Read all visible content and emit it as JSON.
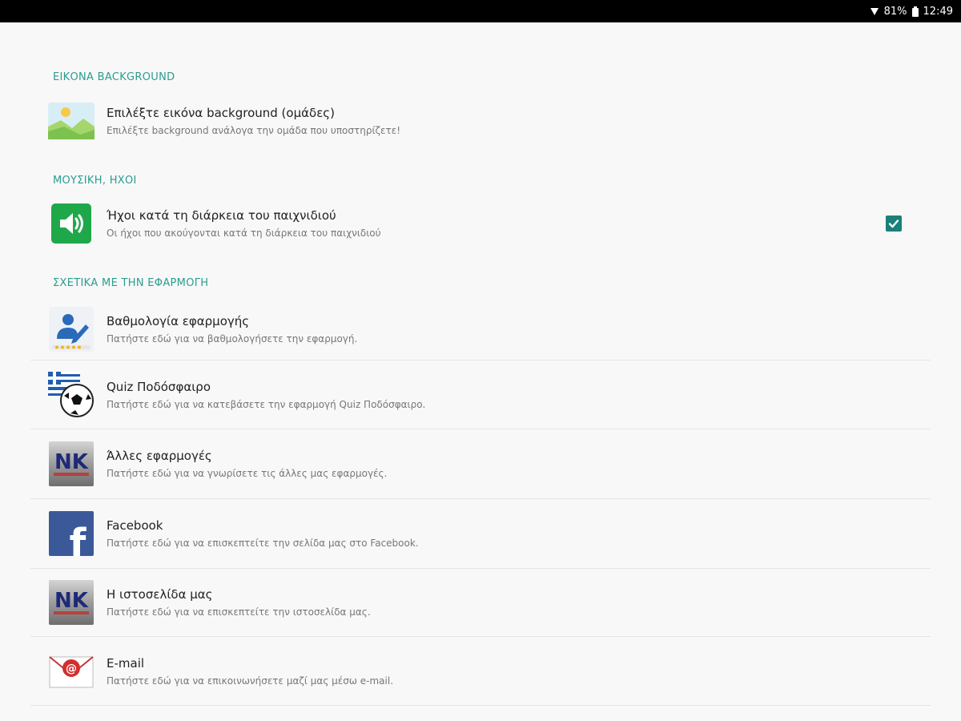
{
  "status_bar": {
    "battery": "81%",
    "time": "12:49"
  },
  "sections": {
    "background": {
      "header": "ΕΙΚΟΝΑ BACKGROUND",
      "items": [
        {
          "title": "Επιλέξτε εικόνα background (ομάδες)",
          "summary": "Επιλέξτε background ανάλογα την ομάδα που υποστηρίζετε!",
          "icon": "landscape-image-icon"
        }
      ]
    },
    "music": {
      "header": "ΜΟΥΣΙΚΗ, ΗΧΟΙ",
      "items": [
        {
          "title": "Ήχοι κατά τη διάρκεια του παιχνιδιού",
          "summary": "Οι ήχοι που ακούγονται κατά τη διάρκεια του παιχνιδιού",
          "icon": "speaker-icon",
          "checked": true
        }
      ]
    },
    "about": {
      "header": "ΣΧΕΤΙΚΑ ΜΕ ΤΗΝ ΕΦΑΡΜΟΓΗ",
      "items": [
        {
          "title": "Βαθμολογία εφαρμογής",
          "summary": "Πατήστε εδώ για να βαθμολογήσετε την εφαρμογή.",
          "icon": "rate-app-icon"
        },
        {
          "title": "Quiz Ποδόσφαιρο",
          "summary": "Πατήστε εδώ για να κατεβάσετε την εφαρμογή Quiz Ποδόσφαιρο.",
          "icon": "soccer-ball-icon"
        },
        {
          "title": "Άλλες εφαρμογές",
          "summary": "Πατήστε εδώ για να γνωρίσετε τις άλλες μας εφαρμογές.",
          "icon": "nk-logo-icon",
          "logo_text": "NK"
        },
        {
          "title": "Facebook",
          "summary": "Πατήστε εδώ για να επισκεπτείτε την σελίδα μας στο Facebook.",
          "icon": "facebook-icon",
          "logo_text": "f"
        },
        {
          "title": "Η ιστοσελίδα μας",
          "summary": "Πατήστε εδώ για να επισκεπτείτε την ιστοσελίδα μας.",
          "icon": "nk-logo-icon",
          "logo_text": "NK"
        },
        {
          "title": "E-mail",
          "summary": "Πατήστε εδώ για να επικοινωνήσετε μαζί μας μέσω e-mail.",
          "icon": "email-envelope-icon",
          "logo_text": "@"
        }
      ]
    }
  },
  "colors": {
    "accent": "#2a9d8f",
    "checkbox": "#1a8079",
    "facebook": "#3b5998",
    "speaker_green": "#1ea84a"
  }
}
